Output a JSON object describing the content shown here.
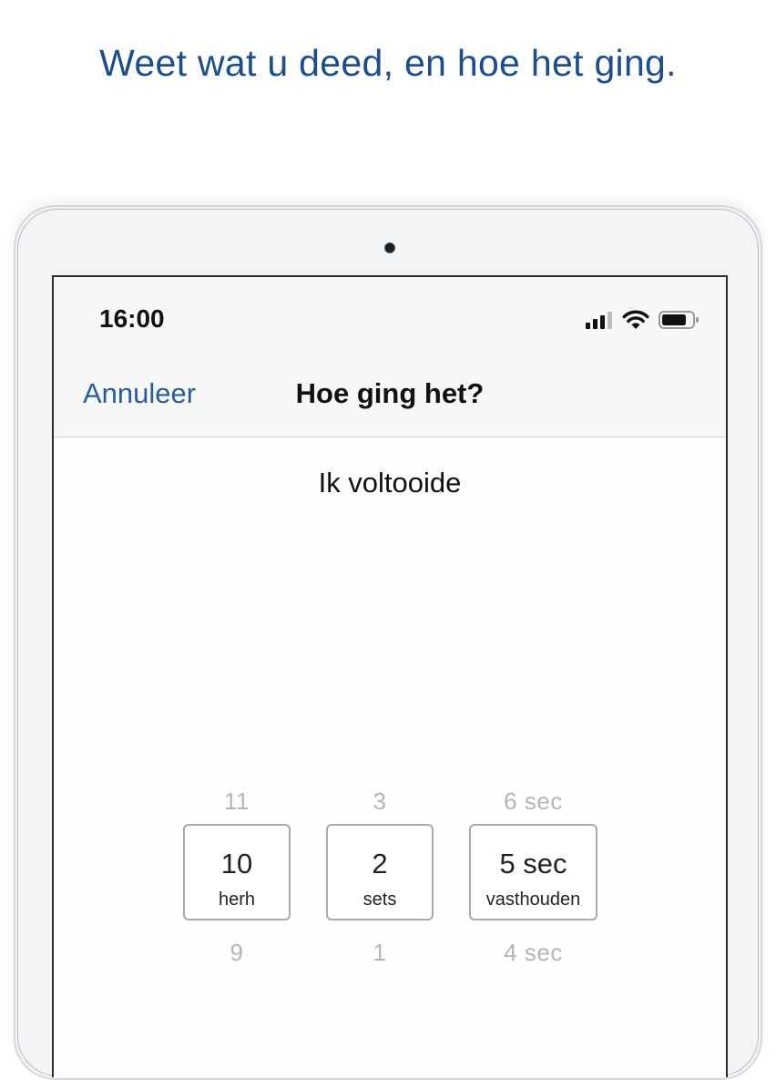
{
  "headline": "Weet wat u deed, en hoe het ging.",
  "status": {
    "time": "16:00"
  },
  "nav": {
    "cancel": "Annuleer",
    "title": "Hoe ging het?"
  },
  "prompt": "Ik voltooide",
  "pickers": {
    "reps": {
      "above": "11",
      "value": "10",
      "unit": "herh",
      "below": "9"
    },
    "sets": {
      "above": "3",
      "value": "2",
      "unit": "sets",
      "below": "1"
    },
    "hold": {
      "above": "6 sec",
      "value": "5 sec",
      "unit": "vasthouden",
      "below": "4 sec"
    }
  }
}
